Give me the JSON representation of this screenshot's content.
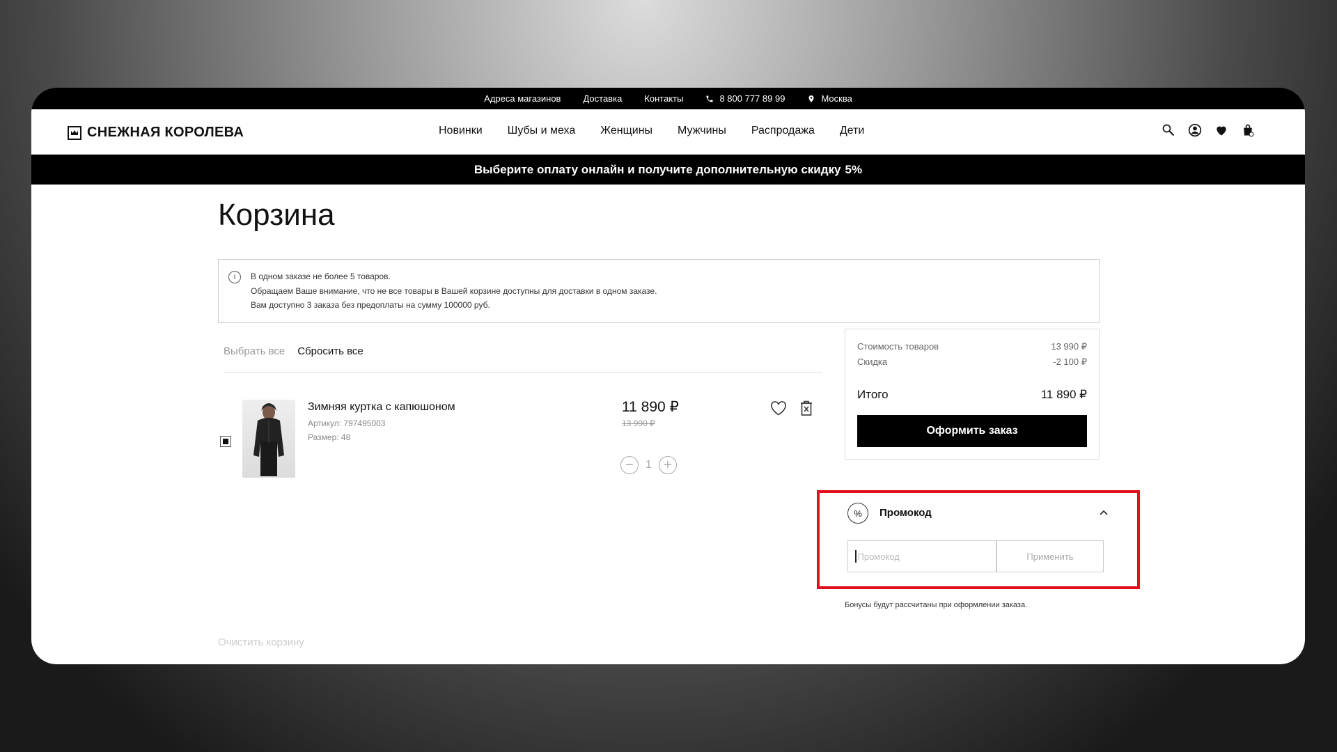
{
  "topbar": {
    "stores": "Адреса магазинов",
    "delivery": "Доставка",
    "contacts": "Контакты",
    "phone": "8 800 777 89 99",
    "city": "Москва"
  },
  "header": {
    "logo": "СНЕЖНАЯ КОРОЛЕВА",
    "nav": [
      "Новинки",
      "Шубы и меха",
      "Женщины",
      "Мужчины",
      "Распродажа",
      "Дети"
    ]
  },
  "banner": {
    "text": "Выберите оплату онлайн и получите дополнительную скидку",
    "discount": "5%"
  },
  "page": {
    "title": "Корзина"
  },
  "info": {
    "icon_label": "i",
    "lines": [
      "В одном заказе не более 5 товаров.",
      "Обращаем Ваше внимание, что не все товары в Вашей корзине доступны для доставки в одном заказе.",
      "Вам доступно 3 заказа без предоплаты на сумму 100000 руб."
    ]
  },
  "selection": {
    "select_all": "Выбрать все",
    "reset_all": "Сбросить все"
  },
  "item": {
    "name": "Зимняя куртка с капюшоном",
    "article": "Артикул: 797495003",
    "size": "Размер: 48",
    "price": "11 890 ₽",
    "old_price": "13 990 ₽",
    "qty": "1",
    "minus": "−",
    "plus": "+"
  },
  "summary": {
    "goods_label": "Стоимость товаров",
    "goods_value": "13 990 ₽",
    "discount_label": "Скидка",
    "discount_value": "-2 100 ₽",
    "total_label": "Итого",
    "total_value": "11 890 ₽",
    "checkout": "Оформить заказ"
  },
  "promo": {
    "icon_label": "%",
    "title": "Промокод",
    "placeholder": "Промокод",
    "apply": "Применить",
    "highlight_color": "#e0101e"
  },
  "bonus_note": "Бонусы будут рассчитаны при оформлении заказа.",
  "clear_cart": "Очистить корзину"
}
